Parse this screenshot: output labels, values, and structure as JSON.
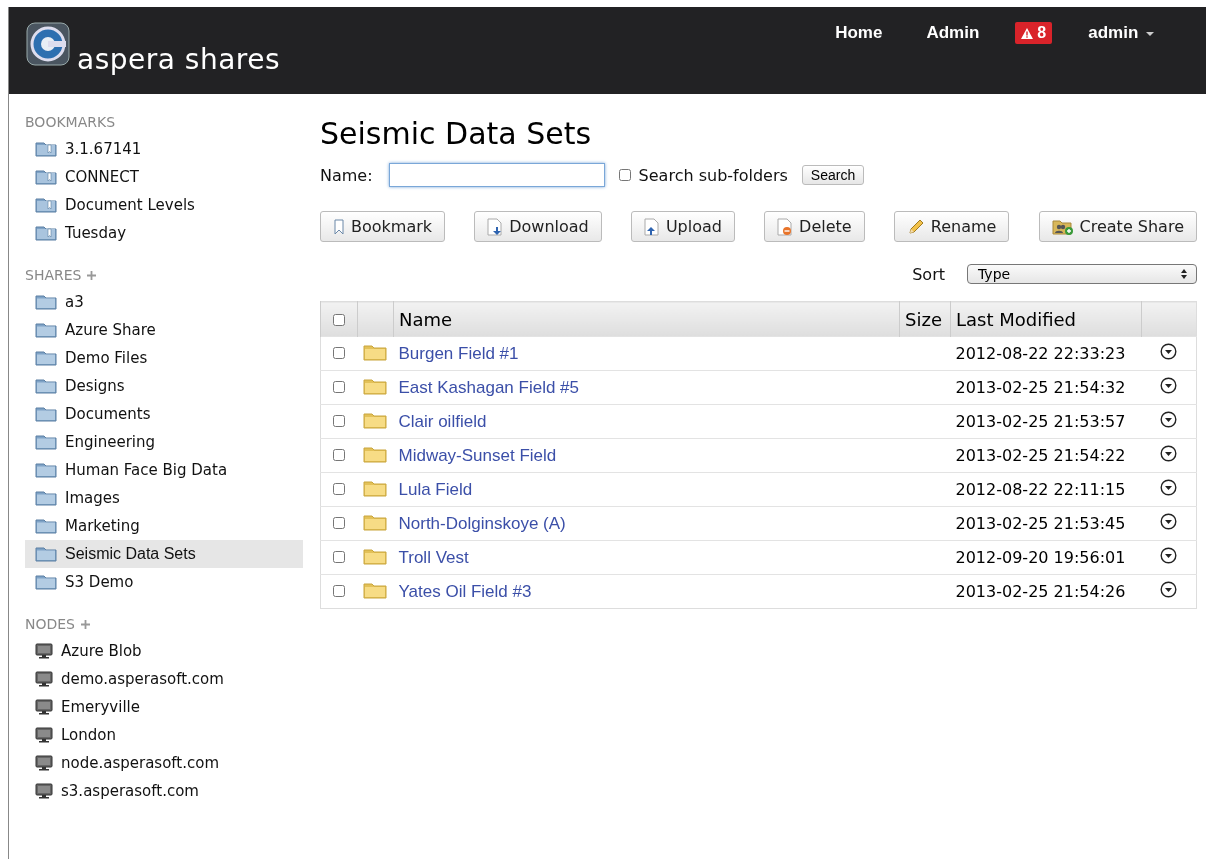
{
  "header": {
    "brand": "aspera shares",
    "nav": [
      {
        "label": "Home",
        "kind": "link"
      },
      {
        "label": "Admin",
        "kind": "link"
      },
      {
        "label": "8",
        "kind": "alert"
      },
      {
        "label": "admin",
        "kind": "menu"
      }
    ]
  },
  "sidebar": {
    "sections": [
      {
        "title": "BOOKMARKS",
        "addable": false,
        "kind": "bookmark",
        "items": [
          {
            "label": "3.1.67141",
            "selected": false
          },
          {
            "label": "CONNECT",
            "selected": false
          },
          {
            "label": "Document Levels",
            "selected": false
          },
          {
            "label": "Tuesday",
            "selected": false
          }
        ]
      },
      {
        "title": "SHARES",
        "addable": true,
        "kind": "folder",
        "items": [
          {
            "label": "a3",
            "selected": false
          },
          {
            "label": "Azure Share",
            "selected": false
          },
          {
            "label": "Demo Files",
            "selected": false
          },
          {
            "label": "Designs",
            "selected": false
          },
          {
            "label": "Documents",
            "selected": false
          },
          {
            "label": "Engineering",
            "selected": false
          },
          {
            "label": "Human Face Big Data",
            "selected": false
          },
          {
            "label": "Images",
            "selected": false
          },
          {
            "label": "Marketing",
            "selected": false
          },
          {
            "label": "Seismic Data Sets",
            "selected": true
          },
          {
            "label": "S3 Demo",
            "selected": false
          }
        ]
      },
      {
        "title": "NODES",
        "addable": true,
        "kind": "node",
        "items": [
          {
            "label": "Azure Blob",
            "selected": false
          },
          {
            "label": "demo.asperasoft.com",
            "selected": false
          },
          {
            "label": "Emeryville",
            "selected": false
          },
          {
            "label": "London",
            "selected": false
          },
          {
            "label": "node.asperasoft.com",
            "selected": false
          },
          {
            "label": "s3.asperasoft.com",
            "selected": false
          }
        ]
      }
    ]
  },
  "main": {
    "title": "Seismic Data Sets",
    "search": {
      "label": "Name:",
      "subfolders": {
        "label": "Search sub-folders",
        "checked": false
      },
      "button": "Search"
    },
    "toolbar": [
      {
        "label": "Bookmark",
        "kind": "bookmark"
      },
      {
        "label": "Download",
        "kind": "download"
      },
      {
        "label": "Upload",
        "kind": "upload"
      },
      {
        "label": "Delete",
        "kind": "delete"
      },
      {
        "label": "Rename",
        "kind": "rename"
      },
      {
        "label": "Create Share",
        "kind": "share"
      }
    ],
    "sort": {
      "label": "Sort",
      "value": "Type"
    },
    "table": {
      "all_checked": false,
      "columns": [
        "Name",
        "Size",
        "Last Modified"
      ],
      "rows": [
        {
          "name": "Burgen Field #1",
          "modified": "2012-08-22 22:33:23",
          "checked": false
        },
        {
          "name": "East Kashagan Field #5",
          "modified": "2013-02-25 21:54:32",
          "checked": false
        },
        {
          "name": "Clair oilfield",
          "modified": "2013-02-25 21:53:57",
          "checked": false
        },
        {
          "name": "Midway-Sunset Field",
          "modified": "2013-02-25 21:54:22",
          "checked": false
        },
        {
          "name": "Lula Field",
          "modified": "2012-08-22 22:11:15",
          "checked": false
        },
        {
          "name": "North-Dolginskoye (A)",
          "modified": "2013-02-25 21:53:45",
          "checked": false
        },
        {
          "name": "Troll Vest",
          "modified": "2012-09-20 19:56:01",
          "checked": false
        },
        {
          "name": "Yates Oil Field #3",
          "modified": "2013-02-25 21:54:26",
          "checked": false
        }
      ]
    }
  }
}
